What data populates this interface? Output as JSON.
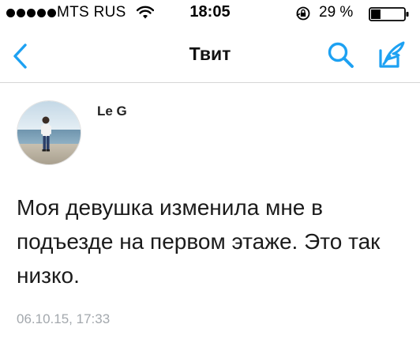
{
  "status_bar": {
    "carrier": "MTS RUS",
    "time": "18:05",
    "battery_percent": "29 %",
    "battery_level": 0.29,
    "signal_bars": 5,
    "icons": [
      "signal-icon",
      "wifi-icon",
      "orientation-lock-icon",
      "battery-icon"
    ]
  },
  "nav": {
    "title": "Твит",
    "icons": [
      "back-icon",
      "search-icon",
      "compose-icon"
    ],
    "accent_color": "#1da1f2"
  },
  "tweet": {
    "author": "Le G",
    "text": "Моя девушка изменила мне в подъезде на первом этаже. Это так низко.",
    "timestamp": "06.10.15, 17:33",
    "avatar_icon": "profile-photo"
  }
}
